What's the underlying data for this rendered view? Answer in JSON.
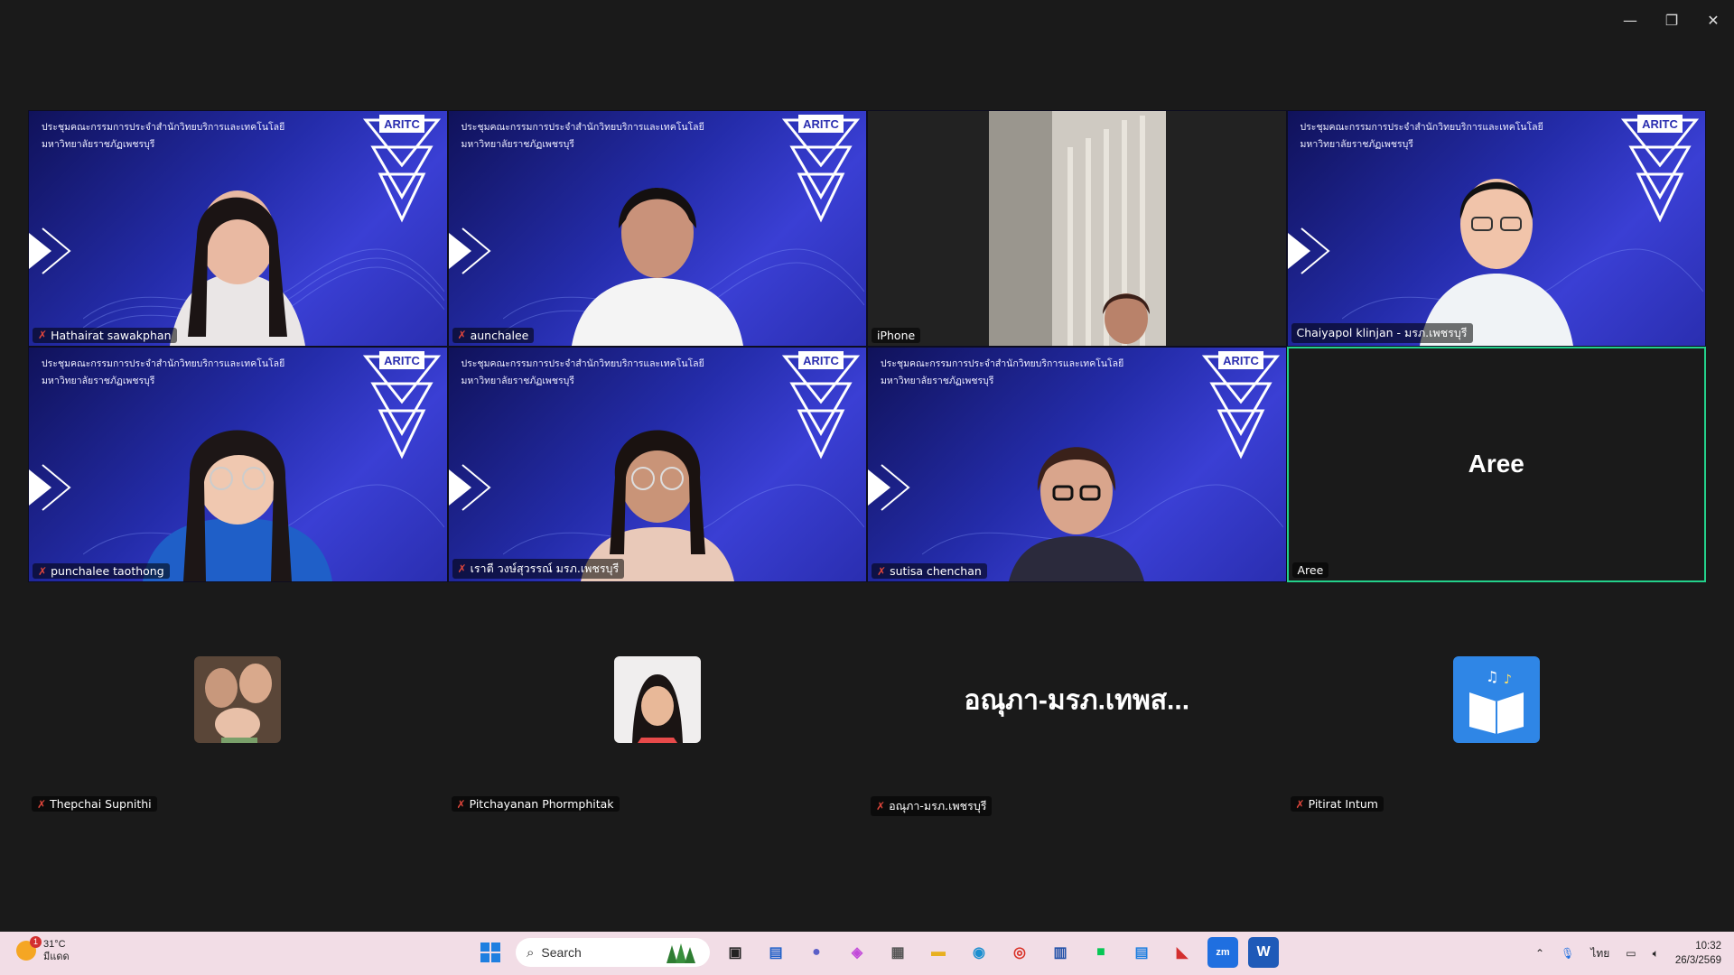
{
  "window": {
    "minimize": "—",
    "restore": "❐",
    "close": "✕"
  },
  "meeting_bg": {
    "line1": "ประชุมคณะกรรมการประจำสำนักวิทยบริการและเทคโนโลยี",
    "line2": "มหาวิทยาลัยราชภัฏเพชรบุรี",
    "logo": "ARITC"
  },
  "tiles": [
    {
      "name": "Hathairat sawakphan",
      "muted": true,
      "bg": "meet"
    },
    {
      "name": "aunchalee",
      "muted": true,
      "bg": "meet"
    },
    {
      "name": "iPhone",
      "muted": false,
      "bg": "dark"
    },
    {
      "name": "Chaiyapol klinjan - มรภ.เพชรบุรี",
      "muted": false,
      "bg": "meet"
    },
    {
      "name": "punchalee taothong",
      "muted": true,
      "bg": "meet"
    },
    {
      "name": "เราตี วงษ์สุวรรณ์ มรภ.เพชรบุรี",
      "muted": true,
      "bg": "meet"
    },
    {
      "name": "sutisa chenchan",
      "muted": true,
      "bg": "meet"
    },
    {
      "name": "Aree",
      "muted": false,
      "bg": "black",
      "display": "Aree",
      "active": true
    }
  ],
  "audio_tiles": [
    {
      "name": "Thepchai Supnithi",
      "muted": true
    },
    {
      "name": "Pitchayanan Phormphitak",
      "muted": true
    },
    {
      "name": "อณุภา-มรภ.เพชรบุรี",
      "muted": true,
      "display": "อณุภา-มรภ.เทพส..."
    },
    {
      "name": "Pitirat Intum",
      "muted": true
    }
  ],
  "taskbar": {
    "weather_temp": "31°C",
    "weather_desc": "มีแดด",
    "search_placeholder": "Search",
    "lang": "ไทย",
    "time": "10:32",
    "date": "26/3/2569"
  },
  "colors": {
    "active_border": "#23d18b",
    "taskbar_bg": "#f2dde6",
    "mute": "#e0463b"
  }
}
